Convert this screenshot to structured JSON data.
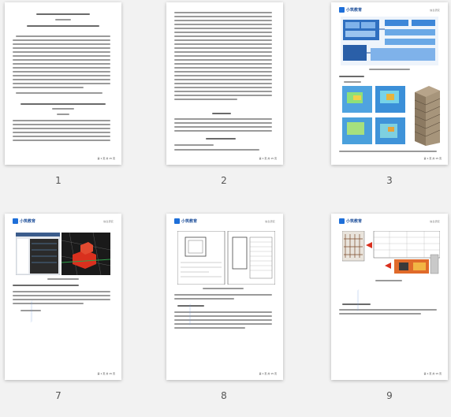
{
  "thumbnails": [
    {
      "number": "1"
    },
    {
      "number": "2"
    },
    {
      "number": "3"
    },
    {
      "number": "7"
    },
    {
      "number": "8"
    },
    {
      "number": "9"
    }
  ],
  "page_header": {
    "left": "信息研究",
    "right": "信息研究"
  },
  "logo_text": "小筑教育",
  "page_footer": "第 1 页 共 15 页",
  "figure_captions": {
    "p3": "图 1 BIM技术的应用框架",
    "p7": "图 4 模型碰撞检查",
    "p9": "图 6 钢筋加工"
  },
  "colors": {
    "brand": "#1e6fd9",
    "accent_red": "#d9301e",
    "page_bg": "#ffffff",
    "canvas_bg": "#f2f2f2"
  }
}
